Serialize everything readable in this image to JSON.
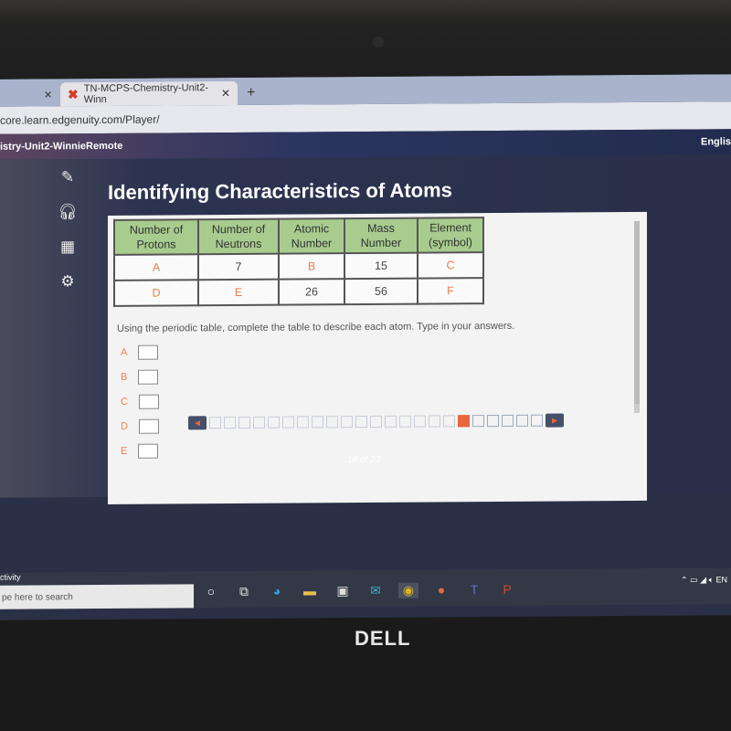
{
  "browser": {
    "tab_title": "TN-MCPS-Chemistry-Unit2-Winn",
    "url": "core.learn.edgenuity.com/Player/"
  },
  "site": {
    "course": "istry-Unit2-WinnieRemote",
    "language": "Englis"
  },
  "tools": [
    "pencil-icon",
    "headphones-icon",
    "calculator-icon",
    "gear-icon"
  ],
  "lesson": {
    "title": "Identifying Characteristics of Atoms",
    "table": {
      "headers": [
        "Number of Protons",
        "Number of Neutrons",
        "Atomic Number",
        "Mass Number",
        "Element (symbol)"
      ],
      "rows": [
        [
          "A",
          "7",
          "B",
          "15",
          "C"
        ],
        [
          "D",
          "E",
          "26",
          "56",
          "F"
        ]
      ]
    },
    "instructions": "Using the periodic table, complete the table to describe each atom. Type in your answers.",
    "answers": [
      {
        "label": "A",
        "value": ""
      },
      {
        "label": "B",
        "value": ""
      },
      {
        "label": "C",
        "value": ""
      },
      {
        "label": "D",
        "value": ""
      },
      {
        "label": "E",
        "value": ""
      }
    ]
  },
  "pagination": {
    "current": 18,
    "total": 23,
    "text": "18 of 23"
  },
  "taskbar": {
    "activity_label": "ctivity",
    "search_placeholder": "pe here to search",
    "tray_lang": "EN"
  },
  "brand": "DELL",
  "colors": {
    "accent": "#e9673d",
    "table_header": "#a7cc8e"
  }
}
